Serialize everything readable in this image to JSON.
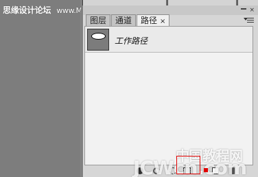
{
  "watermarks": {
    "top_text": "思缘设计论坛",
    "top_url": "www.MISSYUAN.COM",
    "bottom_text_cn": "中国教程网",
    "bottom_text_en": "JCWcn.com"
  },
  "panel": {
    "tabs": [
      {
        "label": "图层"
      },
      {
        "label": "通道"
      },
      {
        "label": "路径",
        "active": true,
        "close": "×"
      }
    ],
    "close_glyph": "×",
    "paths": [
      {
        "name": "工作路径",
        "thumbnail": "ellipse"
      }
    ],
    "bottom_buttons": [
      {
        "icon": "fill-path-icon"
      },
      {
        "icon": "stroke-path-icon"
      },
      {
        "icon": "load-selection-icon"
      },
      {
        "icon": "make-work-path-icon"
      },
      {
        "icon": "new-path-icon"
      },
      {
        "icon": "delete-path-icon"
      }
    ]
  },
  "colors": {
    "canvas_bg": "#7d7d7d",
    "panel_bg": "#d6d6d6",
    "highlight": "#e00000"
  }
}
